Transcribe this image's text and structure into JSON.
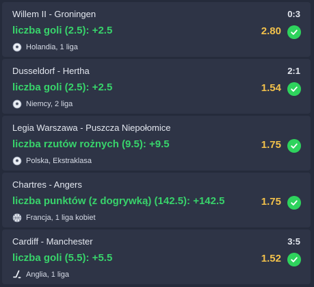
{
  "bets": [
    {
      "match": "Willem II - Groningen",
      "score": "0:3",
      "bet": "liczba goli (2.5): +2.5",
      "odds": "2.80",
      "league": "Holandia, 1 liga",
      "sport_icon": "soccer-ball-icon",
      "status_icon": "check-icon"
    },
    {
      "match": "Dusseldorf - Hertha",
      "score": "2:1",
      "bet": "liczba goli (2.5): +2.5",
      "odds": "1.54",
      "league": "Niemcy, 2 liga",
      "sport_icon": "soccer-ball-icon",
      "status_icon": "check-icon"
    },
    {
      "match": "Legia Warszawa - Puszcza Niepołomice",
      "score": "",
      "bet": "liczba rzutów rożnych (9.5): +9.5",
      "odds": "1.75",
      "league": "Polska, Ekstraklasa",
      "sport_icon": "soccer-ball-icon",
      "status_icon": "check-icon"
    },
    {
      "match": "Chartres - Angers",
      "score": "",
      "bet": "liczba punktów (z dogrywką) (142.5): +142.5",
      "odds": "1.75",
      "league": "Francja, 1 liga kobiet",
      "sport_icon": "basketball-icon",
      "status_icon": "check-icon"
    },
    {
      "match": "Cardiff - Manchester",
      "score": "3:5",
      "bet": "liczba goli (5.5): +5.5",
      "odds": "1.52",
      "league": "Anglia, 1 liga",
      "sport_icon": "hockey-stick-icon",
      "status_icon": "check-icon"
    }
  ],
  "colors": {
    "background": "#252b3b",
    "card": "#2e3446",
    "bet_text": "#38d36b",
    "odds_text": "#f2c14b",
    "check_bg": "#2ed35d"
  }
}
